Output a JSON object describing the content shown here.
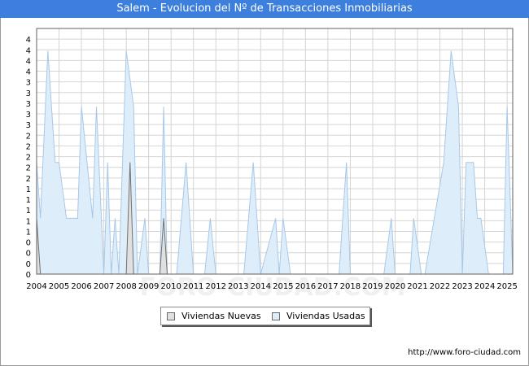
{
  "header": {
    "title": "Salem - Evolucion del Nº de Transacciones Inmobiliarias"
  },
  "footer": {
    "url": "http://www.foro-ciudad.com"
  },
  "watermark": "FORO-CIUDAD.COM",
  "colors": {
    "header_bg": "#3d7fdc",
    "series_usadas_fill": "#ddeefa",
    "series_usadas_line": "#a8c8e8",
    "series_nuevas_fill": "#e0e0e0",
    "series_nuevas_line": "#707070",
    "grid": "#d4d4d4"
  },
  "chart_data": {
    "type": "area",
    "title": "Salem - Evolucion del Nº de Transacciones Inmobiliarias",
    "xlabel": "",
    "ylabel": "",
    "ylim": [
      0,
      4.4
    ],
    "y_tick_labels": [
      "0",
      "0",
      "0",
      "0",
      "1",
      "1",
      "1",
      "1",
      "1",
      "2",
      "2",
      "2",
      "2",
      "2",
      "3",
      "3",
      "3",
      "3",
      "3",
      "4",
      "4",
      "4",
      "4"
    ],
    "x_tick_labels": [
      "2004",
      "2005",
      "2006",
      "2007",
      "2008",
      "2009",
      "2010",
      "2011",
      "2012",
      "2013",
      "2014",
      "2015",
      "2016",
      "2017",
      "2018",
      "2019",
      "2020",
      "2021",
      "2022",
      "2023",
      "2024",
      "2025"
    ],
    "grid": true,
    "legend_position": "bottom-center",
    "series": [
      {
        "name": "Viviendas Nuevas",
        "points": [
          [
            2004.0,
            1
          ],
          [
            2004.17,
            0
          ],
          [
            2008.0,
            0
          ],
          [
            2008.17,
            2
          ],
          [
            2008.33,
            0
          ],
          [
            2009.5,
            0
          ],
          [
            2009.67,
            1
          ],
          [
            2009.83,
            0
          ],
          [
            2025.25,
            0
          ]
        ]
      },
      {
        "name": "Viviendas Usadas",
        "points": [
          [
            2004.0,
            2
          ],
          [
            2004.17,
            1
          ],
          [
            2004.5,
            4
          ],
          [
            2004.83,
            2
          ],
          [
            2005.0,
            2
          ],
          [
            2005.33,
            1
          ],
          [
            2005.83,
            1
          ],
          [
            2006.0,
            3
          ],
          [
            2006.5,
            1
          ],
          [
            2006.67,
            3
          ],
          [
            2007.0,
            0
          ],
          [
            2007.17,
            2
          ],
          [
            2007.33,
            0
          ],
          [
            2007.5,
            1
          ],
          [
            2007.67,
            0
          ],
          [
            2008.0,
            4
          ],
          [
            2008.33,
            3
          ],
          [
            2008.5,
            0
          ],
          [
            2008.83,
            1
          ],
          [
            2009.0,
            0
          ],
          [
            2009.5,
            0
          ],
          [
            2009.67,
            3
          ],
          [
            2009.83,
            0
          ],
          [
            2010.25,
            0
          ],
          [
            2010.67,
            2
          ],
          [
            2011.0,
            0
          ],
          [
            2011.5,
            0
          ],
          [
            2011.75,
            1
          ],
          [
            2012.0,
            0
          ],
          [
            2012.83,
            0
          ],
          [
            2013.25,
            0
          ],
          [
            2013.67,
            2
          ],
          [
            2014.0,
            0
          ],
          [
            2014.67,
            1
          ],
          [
            2014.83,
            0
          ],
          [
            2015.0,
            1
          ],
          [
            2015.33,
            0
          ],
          [
            2017.5,
            0
          ],
          [
            2017.83,
            2
          ],
          [
            2018.0,
            0
          ],
          [
            2019.5,
            0
          ],
          [
            2019.83,
            1
          ],
          [
            2020.0,
            0
          ],
          [
            2020.67,
            0
          ],
          [
            2020.83,
            1
          ],
          [
            2021.17,
            0
          ],
          [
            2021.33,
            0
          ],
          [
            2022.17,
            2
          ],
          [
            2022.5,
            4
          ],
          [
            2022.83,
            3
          ],
          [
            2023.0,
            0
          ],
          [
            2023.17,
            2
          ],
          [
            2023.5,
            2
          ],
          [
            2023.67,
            1
          ],
          [
            2023.83,
            1
          ],
          [
            2024.17,
            0
          ],
          [
            2024.67,
            0
          ],
          [
            2024.83,
            0
          ],
          [
            2025.0,
            3
          ],
          [
            2025.25,
            0
          ]
        ]
      }
    ]
  }
}
